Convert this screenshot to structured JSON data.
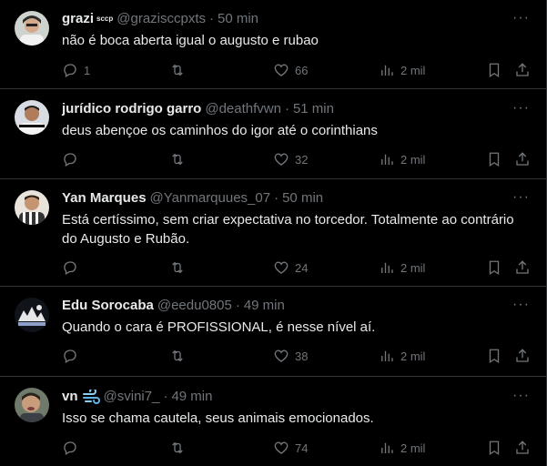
{
  "tweets": [
    {
      "name": "grazi",
      "name_badge": "sccp",
      "handle": "@grazisccpxts",
      "time": "50 min",
      "text": "não é boca aberta igual o augusto e rubao",
      "replies": "1",
      "retweets": "",
      "likes": "66",
      "views": "2 mil"
    },
    {
      "name": "jurídico rodrigo garro",
      "handle": "@deathfvwn",
      "time": "51 min",
      "text": "deus abençoe os caminhos do igor até o corinthians",
      "replies": "",
      "retweets": "",
      "likes": "32",
      "views": "2 mil"
    },
    {
      "name": "Yan Marques",
      "handle": "@Yanmarquues_07",
      "time": "50 min",
      "text": "Está certíssimo, sem criar expectativa no torcedor. Totalmente ao contrário do Augusto e Rubão.",
      "replies": "",
      "retweets": "",
      "likes": "24",
      "views": "2 mil"
    },
    {
      "name": "Edu Sorocaba",
      "handle": "@eedu0805",
      "time": "49 min",
      "text": "Quando o cara é PROFISSIONAL, é nesse nível aí.",
      "replies": "",
      "retweets": "",
      "likes": "38",
      "views": "2 mil"
    },
    {
      "name": "vn",
      "handle": "@svini7_",
      "time": "49 min",
      "text": "Isso se chama cautela, seus animais emocionados.",
      "replies": "",
      "retweets": "",
      "likes": "74",
      "views": "2 mil"
    }
  ],
  "separator": "·",
  "more_label": "···",
  "colors": {
    "background": "#000000",
    "text": "#e7e9ea",
    "muted": "#71767b",
    "border": "#2f3336"
  }
}
